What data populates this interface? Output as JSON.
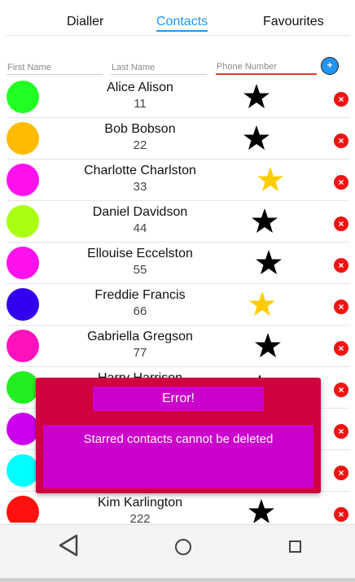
{
  "tabs": {
    "dialler": "Dialler",
    "contacts": "Contacts",
    "favourites": "Favourites",
    "active": "contacts"
  },
  "form": {
    "first_name_placeholder": "First Name",
    "last_name_placeholder": "Last Name",
    "phone_placeholder": "Phone Number",
    "add_label": "+"
  },
  "contacts": [
    {
      "name": "Alice Alison",
      "number": "11",
      "avatar_color": "#22ff22",
      "starred": false
    },
    {
      "name": "Bob Bobson",
      "number": "22",
      "avatar_color": "#ffbb00",
      "starred": false
    },
    {
      "name": "Charlotte Charlston",
      "number": "33",
      "avatar_color": "#ff11ee",
      "starred": true
    },
    {
      "name": "Daniel Davidson",
      "number": "44",
      "avatar_color": "#aaff11",
      "starred": false
    },
    {
      "name": "Ellouise Eccelston",
      "number": "55",
      "avatar_color": "#ff11ee",
      "starred": false
    },
    {
      "name": "Freddie Francis",
      "number": "66",
      "avatar_color": "#3300ee",
      "starred": true
    },
    {
      "name": "Gabriella Gregson",
      "number": "77",
      "avatar_color": "#ff11bb",
      "starred": false
    },
    {
      "name": "Harry Harrison",
      "number": "",
      "avatar_color": "#22ee22",
      "starred": false
    },
    {
      "name": "",
      "number": "",
      "avatar_color": "#cc00ee",
      "starred": false
    },
    {
      "name": "",
      "number": "",
      "avatar_color": "#00ffff",
      "starred": false
    },
    {
      "name": "Kim Karlington",
      "number": "222",
      "avatar_color": "#ff1111",
      "starred": false
    }
  ],
  "delete_label": "×",
  "dialog": {
    "title": "Error!",
    "message": "Starred contacts cannot be deleted"
  },
  "colors": {
    "accent": "#2196f3",
    "star_filled": "#ffcc00",
    "star_plain": "#000000",
    "delete": "#f01414",
    "dialog_bg": "#d0033f",
    "dialog_panel": "#cc00cc"
  },
  "nav": {
    "back_icon": "triangle-back-icon",
    "home_icon": "circle-home-icon",
    "recent_icon": "square-recent-icon"
  }
}
